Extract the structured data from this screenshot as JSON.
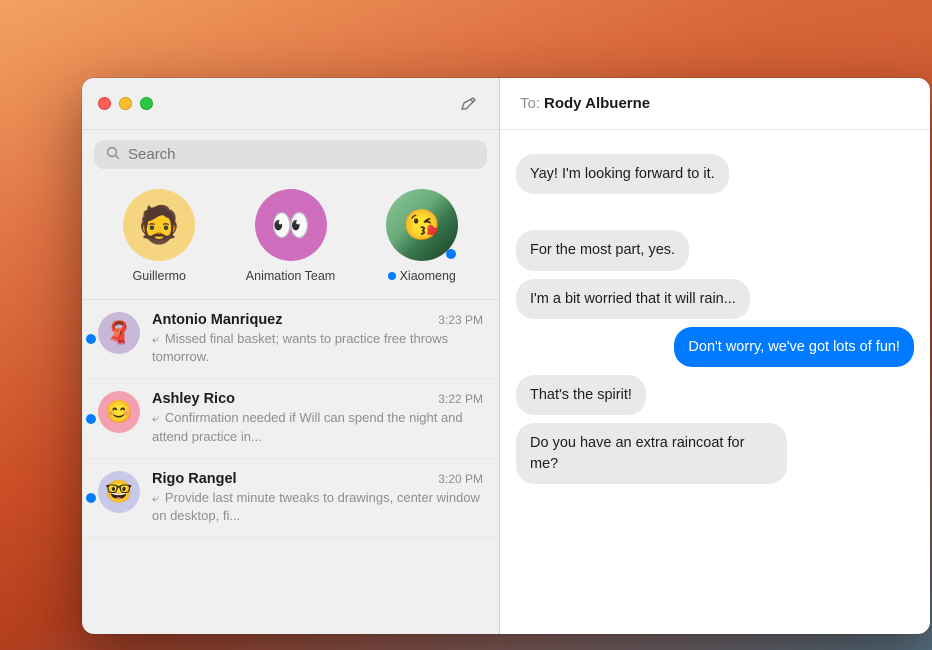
{
  "window": {
    "titlebar": {
      "compose_label": "✏"
    },
    "search": {
      "placeholder": "Search"
    },
    "pinned_contacts": [
      {
        "id": "guillermo",
        "name": "Guillermo",
        "emoji": "🧔",
        "bg": "#f5d580",
        "has_unread": false
      },
      {
        "id": "animation-team",
        "name": "Animation Team",
        "emoji": "👀",
        "bg": "#d06ebe",
        "has_unread": false
      },
      {
        "id": "xiaomeng",
        "name": "Xiaomeng",
        "emoji": "😘",
        "bg": "#f4a0b0",
        "has_unread": true
      }
    ],
    "conversations": [
      {
        "id": "antonio",
        "name": "Antonio Manriquez",
        "time": "3:23 PM",
        "preview": "Missed final basket; wants to practice free throws tomorrow.",
        "emoji": "🧣",
        "bg": "#c8b8d8",
        "unread": true
      },
      {
        "id": "ashley",
        "name": "Ashley Rico",
        "time": "3:22 PM",
        "preview": "Confirmation needed if Will can spend the night and attend practice in...",
        "emoji": "😊",
        "bg": "#f4a0b0",
        "unread": true
      },
      {
        "id": "rigo",
        "name": "Rigo Rangel",
        "time": "3:20 PM",
        "preview": "Provide last minute tweaks to drawings, center window on desktop, fi...",
        "emoji": "🤓",
        "bg": "#c8c8e8",
        "unread": true
      }
    ],
    "chat": {
      "to_label": "To:",
      "to_name": "Rody Albuerne",
      "messages": [
        {
          "id": "msg1",
          "text": "Yay! I'm looking forward to it.",
          "type": "received"
        },
        {
          "id": "msg2",
          "text": "For the most part, yes.",
          "type": "received"
        },
        {
          "id": "msg3",
          "text": "I'm a bit worried that it will rain...",
          "type": "received"
        },
        {
          "id": "msg4",
          "text": "Don't worry, we've got lots of fun!",
          "type": "sent"
        },
        {
          "id": "msg5",
          "text": "That's the spirit!",
          "type": "received"
        },
        {
          "id": "msg6",
          "text": "Do you have an extra raincoat for me?",
          "type": "received"
        }
      ]
    }
  }
}
